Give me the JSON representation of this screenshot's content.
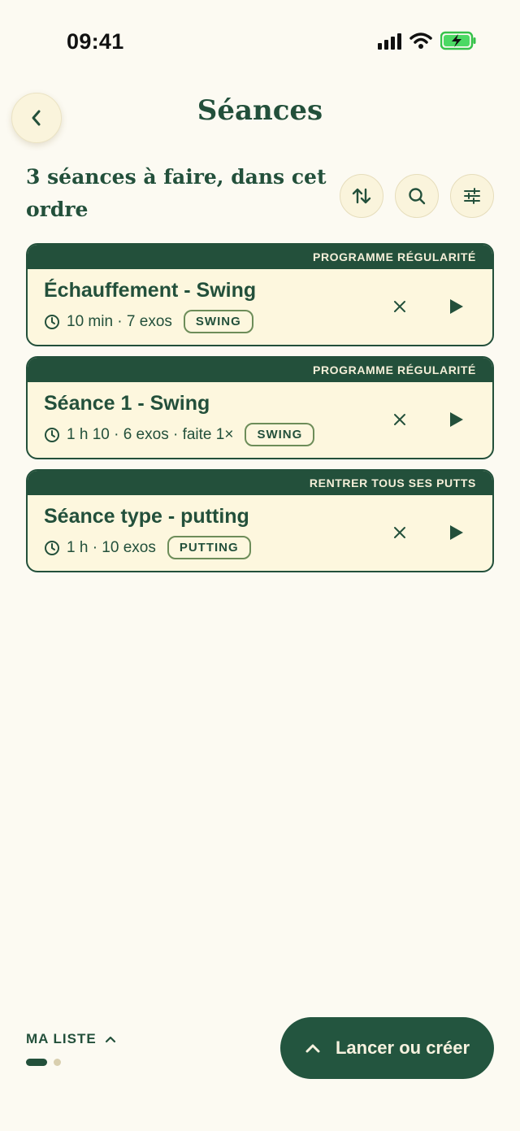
{
  "status_bar": {
    "time": "09:41"
  },
  "header": {
    "title": "Séances"
  },
  "summary": {
    "text": "3 séances à faire, dans cet ordre"
  },
  "toolbar": {
    "icons": [
      "sort-icon",
      "search-icon",
      "filter-icon"
    ]
  },
  "sessions": [
    {
      "program": "PROGRAMME RÉGULARITÉ",
      "title": "Échauffement - Swing",
      "meta": "10 min · 7 exos",
      "tag": "SWING"
    },
    {
      "program": "PROGRAMME RÉGULARITÉ",
      "title": "Séance 1 - Swing",
      "meta": "1 h 10 · 6 exos · faite 1×",
      "tag": "SWING"
    },
    {
      "program": "RENTRER TOUS SES PUTTS",
      "title": "Séance type - putting",
      "meta": "1 h · 10 exos",
      "tag": "PUTTING"
    }
  ],
  "footer": {
    "list_label": "MA LISTE",
    "cta_label": "Lancer ou créer"
  },
  "colors": {
    "primary": "#23503b",
    "background": "#fcfaf2",
    "card": "#fdf7de",
    "tag_border": "#6d8d59"
  }
}
